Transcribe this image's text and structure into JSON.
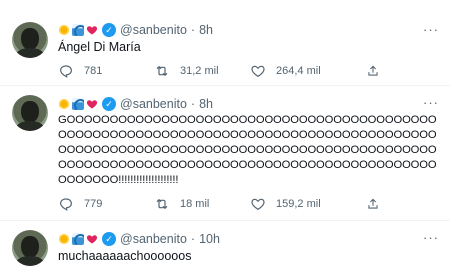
{
  "tweets": [
    {
      "handle": "@sanbenito",
      "separator": "·",
      "time": "8h",
      "text": "Ángel Di María",
      "more": "···",
      "replies": "781",
      "retweets": "31,2 mil",
      "likes": "264,4 mil"
    },
    {
      "handle": "@sanbenito",
      "separator": "·",
      "time": "8h",
      "text": "GOOOOOOOOOOOOOOOOOOOOOOOOOOOOOOOOOOOOOOOOOOOOOOOOOOOOOOOOOOOOOOOOOOOOOOOOOOOOOOOOOOOOOOOOOOOOOOOOOOOOOOOOOOOOOOOOOOOOOOOOOOOOOOOOOOOOOOOOOOOOOOOOOOOOOOOOOOOOOOOOOOOOOOOOOOOOOOOOOOOOOO!!!!!!!!!!!!!!!!!!!!",
      "more": "···",
      "replies": "779",
      "retweets": "18 mil",
      "likes": "159,2 mil"
    },
    {
      "handle": "@sanbenito",
      "separator": "·",
      "time": "10h",
      "text": "muchaaaaaachoooooos",
      "more": "···"
    }
  ],
  "icons": {
    "emoji_1": "sun-icon",
    "emoji_2": "wave-icon",
    "emoji_3": "red-heart-icon",
    "verified": "verified-badge-icon",
    "reply": "reply-icon",
    "retweet": "retweet-icon",
    "like": "like-icon",
    "share": "share-icon"
  },
  "colors": {
    "verified": "#1d9bf0",
    "secondary_text": "#536471",
    "primary_text": "#0f1419",
    "heart": "#e0245e"
  }
}
